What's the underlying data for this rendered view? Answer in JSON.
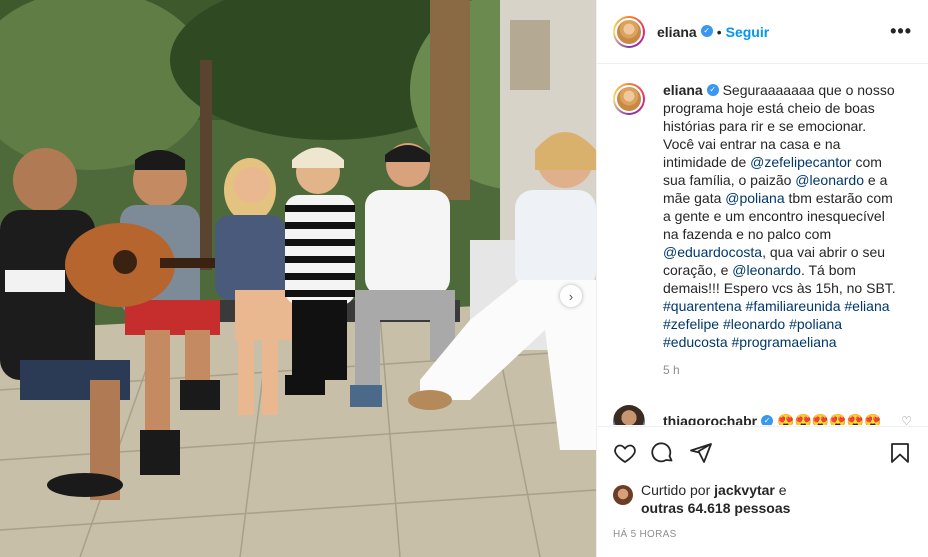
{
  "post": {
    "author": "eliana",
    "follow_label": "Seguir",
    "dot": "•",
    "more_label": "•••",
    "caption": {
      "username": "eliana",
      "t1": "Seguraaaaaaa que o nosso programa hoje está cheio de boas histórias para rir e se emocionar. Você vai entrar na casa e na intimidade de ",
      "m1": "@zefelipecantor",
      "t2": " com sua família, o paizão ",
      "m2": "@leonardo",
      "t3": " e a mãe gata ",
      "m3": "@poliana",
      "t4": " tbm estarão com a gente e um encontro inesquecível na fazenda e no palco com ",
      "m4": "@eduardocosta",
      "t5": ", qua vai abrir o seu coração, e ",
      "m5": "@leonardo",
      "t6": ". Tá bom demais!!! Espero vcs às 15h, no SBT. ",
      "h1": "#quarentena",
      "h2": "#familiareunida",
      "h3": "#eliana",
      "h4": "#zefelipe",
      "h5": "#leonardo",
      "h6": "#poliana",
      "h7": "#educosta",
      "h8": "#programaeliana",
      "age": "5 h"
    },
    "comment": {
      "username": "thiagorochabr",
      "text": "😍😍😍😍😍😍",
      "like_icon": "♡"
    },
    "liked_by": {
      "prefix": "Curtido por ",
      "user": "jackvytar",
      "and": " e",
      "others": "outras 64.618 pessoas"
    },
    "timestamp": "HÁ 5 HORAS",
    "carousel_next": "›"
  },
  "icons": {
    "like": "heart-icon",
    "comment": "comment-icon",
    "share": "share-icon",
    "save": "bookmark-icon",
    "verified": "verified-badge-icon"
  },
  "colors": {
    "link": "#00376b",
    "follow": "#0095f6",
    "verified": "#3897f0",
    "muted": "#8e8e8e"
  }
}
